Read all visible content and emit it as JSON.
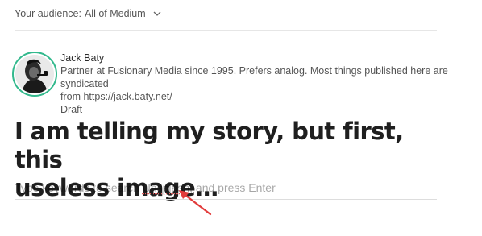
{
  "audience": {
    "label": "Your audience:",
    "value": "All of Medium",
    "icon": "chevron-down-icon"
  },
  "author": {
    "name": "Jack Baty",
    "bio_line1": "Partner at Fusionary Media since 1995. Prefers analog. Most things published here are syndicated",
    "bio_line2": "from https://jack.baty.net/",
    "status": "Draft"
  },
  "post": {
    "title_line1": "I am telling my story, but first, this",
    "title_line2": "useless image…"
  },
  "embed": {
    "prefix": "Type keywords to search ",
    "highlight": "Unsplash",
    "suffix": ", and press Enter"
  },
  "colors": {
    "ring": "#33b98d",
    "arrow": "#e23b3b",
    "spellcheck": "#e05c5c"
  }
}
